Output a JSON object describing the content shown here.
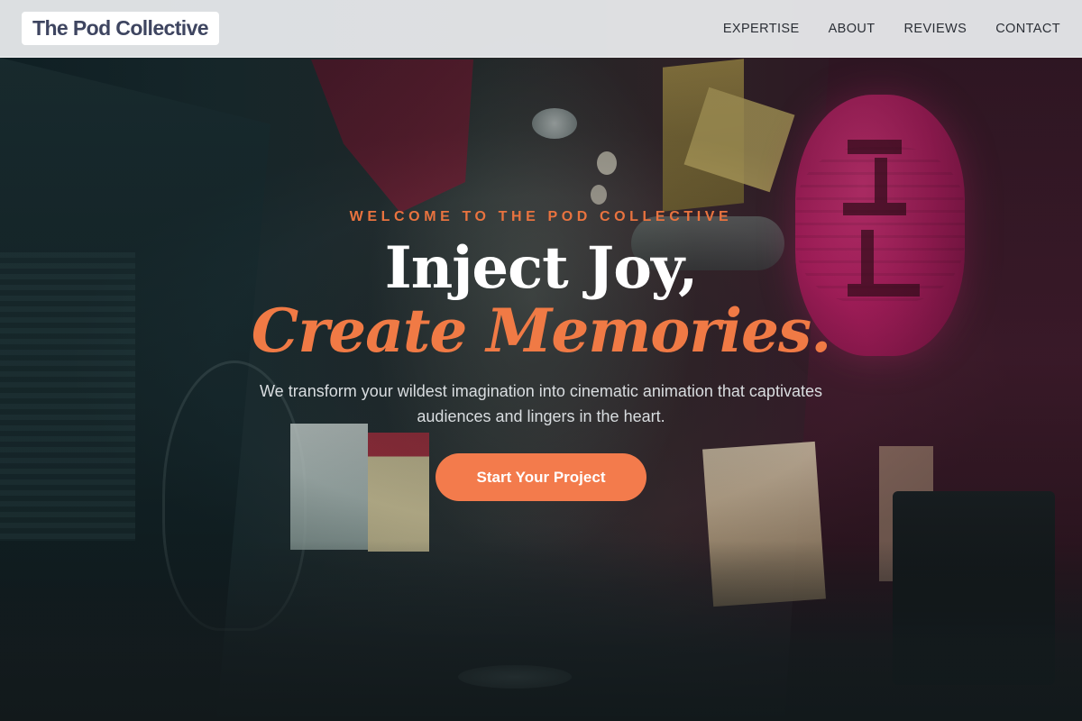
{
  "header": {
    "brand": "The Pod Collective",
    "nav": [
      {
        "label": "EXPERTISE"
      },
      {
        "label": "ABOUT"
      },
      {
        "label": "REVIEWS"
      },
      {
        "label": "CONTACT"
      }
    ]
  },
  "hero": {
    "eyebrow": "WELCOME TO THE POD COLLECTIVE",
    "headline_line1": "Inject Joy,",
    "headline_line2": "Create Memories.",
    "subtext": "We transform your wildest imagination into cinematic animation that captivates audiences and lingers in the heart.",
    "cta_label": "Start Your Project",
    "background_image": "night-alley-photo"
  },
  "colors": {
    "accent": "#f07a45",
    "cta_background": "#f37b4c",
    "brand_text": "#3e4560",
    "nav_background": "#eceef0"
  }
}
